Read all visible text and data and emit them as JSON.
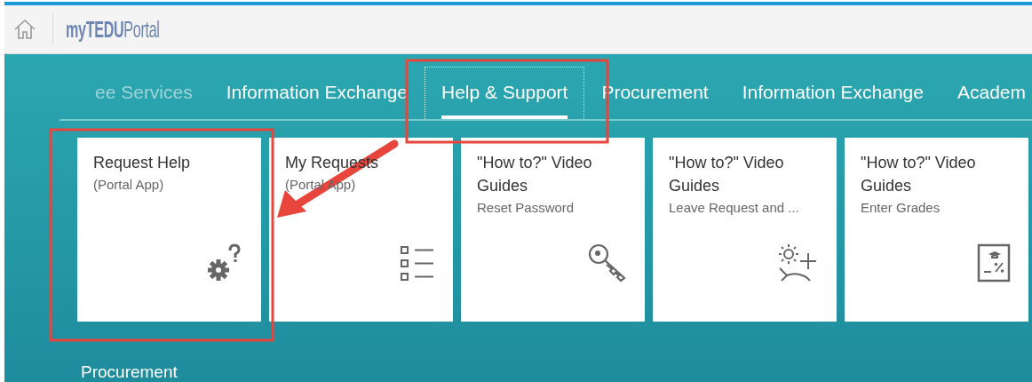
{
  "header": {
    "logo": "**myTEDU**Portal"
  },
  "tabs": [
    {
      "label": "ee Services",
      "selected": false,
      "faded": true
    },
    {
      "label": "Information Exchange",
      "selected": false,
      "faded": false
    },
    {
      "label": "Help & Support",
      "selected": true,
      "faded": false
    },
    {
      "label": "Procurement",
      "selected": false,
      "faded": false
    },
    {
      "label": "Information Exchange",
      "selected": false,
      "faded": false
    },
    {
      "label": "Academ",
      "selected": false,
      "faded": false
    }
  ],
  "tiles": [
    {
      "title": "Request Help",
      "subtitle": "(Portal App)",
      "kind": "help"
    },
    {
      "title": "My Requests",
      "subtitle": "(Portal App)",
      "kind": "list"
    },
    {
      "title": "\"How to?\" Video Guides",
      "subtitle": "Reset Password",
      "kind": "key"
    },
    {
      "title": "\"How to?\" Video Guides",
      "subtitle": "Leave Request and ...",
      "kind": "vacation"
    },
    {
      "title": "\"How to?\" Video Guides",
      "subtitle": "Enter Grades",
      "kind": "grades"
    }
  ],
  "next_section": {
    "title": "Procurement"
  }
}
